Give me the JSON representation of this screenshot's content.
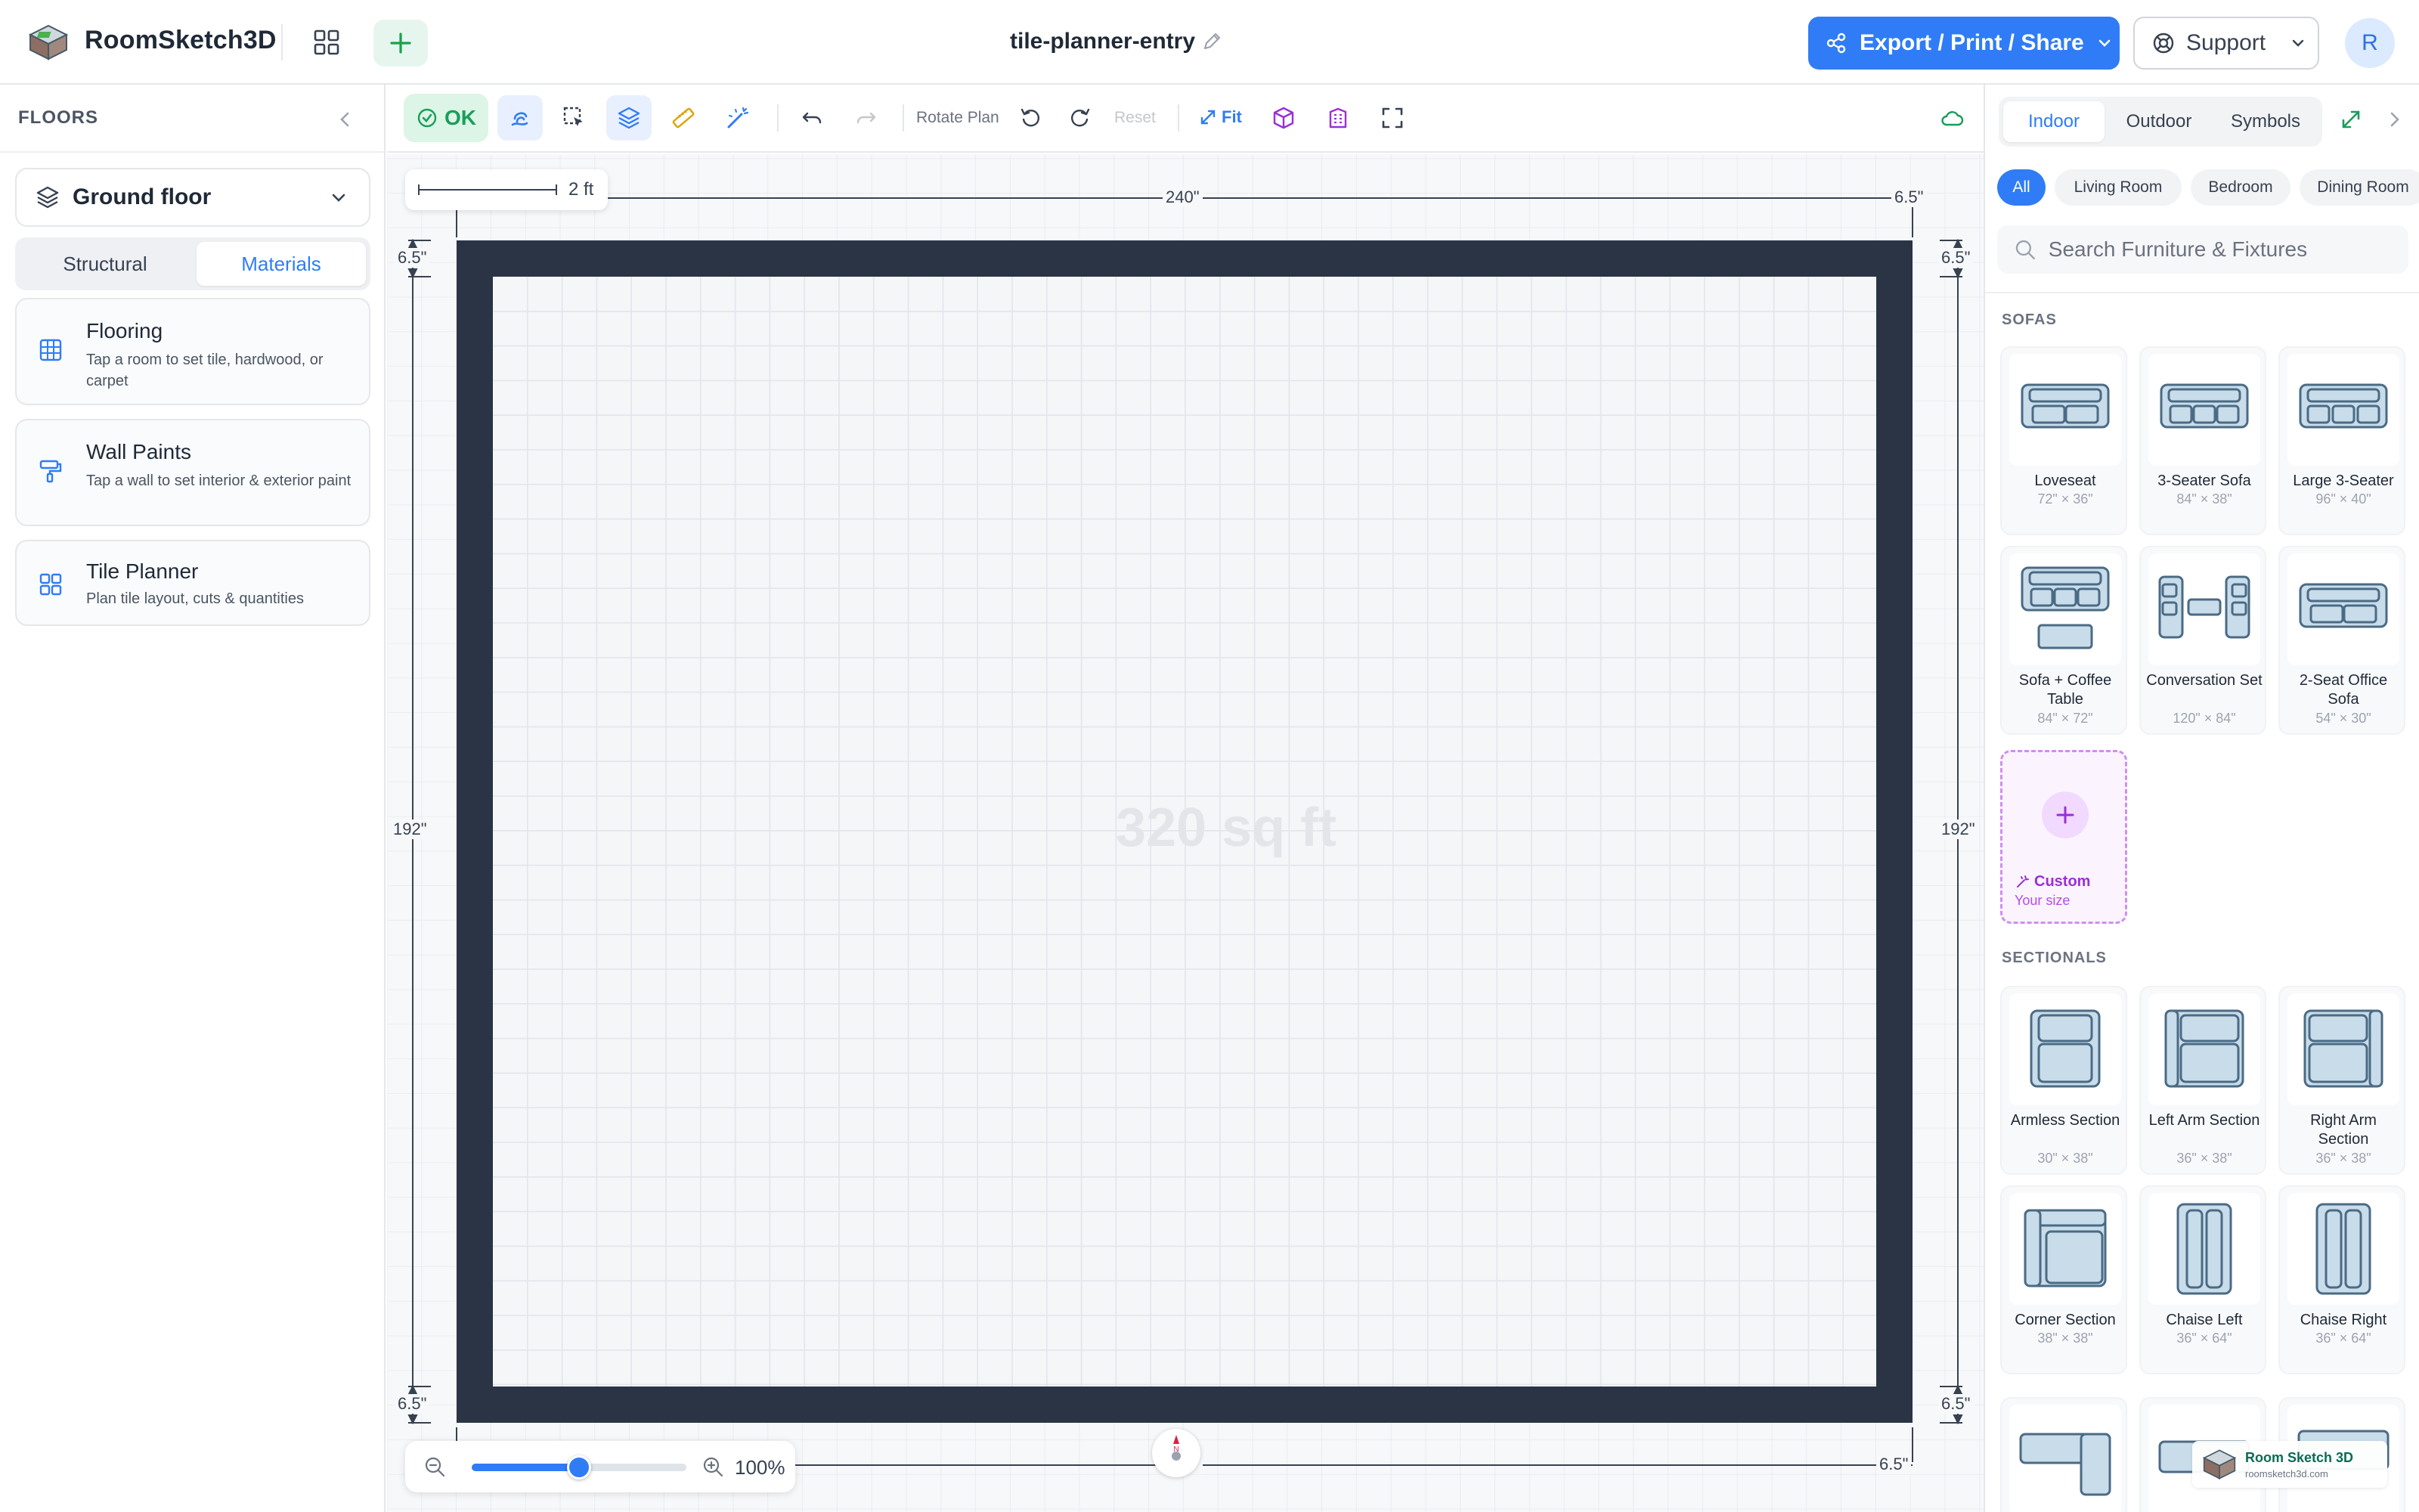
{
  "header": {
    "app_name": "RoomSketch3D",
    "project_title": "tile-planner-entry",
    "export_label": "Export / Print / Share",
    "support_label": "Support",
    "avatar_initial": "R",
    "accent_color": "#2f7cf6"
  },
  "sidebar": {
    "title": "FLOORS",
    "floor_selected": "Ground floor",
    "segments": [
      "Structural",
      "Materials"
    ],
    "active_segment": "Materials",
    "materials": [
      {
        "icon": "grid-icon",
        "title": "Flooring",
        "desc": "Tap a room to set tile, hardwood, or carpet"
      },
      {
        "icon": "paint-roller-icon",
        "title": "Wall Paints",
        "desc": "Tap a wall to set interior & exterior paint"
      },
      {
        "icon": "tiles-icon",
        "title": "Tile Planner",
        "desc": "Plan tile layout, cuts & quantities"
      }
    ]
  },
  "toolbar": {
    "ok_label": "OK",
    "rotate_label": "Rotate Plan",
    "reset_label": "Reset",
    "fit_label": "Fit"
  },
  "canvas": {
    "scale_label": "2 ft",
    "dim_width": "240\"",
    "dim_height": "192\"",
    "dim_wall": "6.5\"",
    "area_label": "320 sq ft",
    "zoom_label": "100%",
    "zoom_level": 0.5,
    "compass_n": "N"
  },
  "right_panel": {
    "tabs": [
      "Indoor",
      "Outdoor",
      "Symbols"
    ],
    "active_tab": "Indoor",
    "categories": [
      "All",
      "Living Room",
      "Bedroom",
      "Dining Room"
    ],
    "active_category": "All",
    "search_placeholder": "Search Furniture & Fixtures",
    "sections": [
      {
        "label": "SOFAS",
        "items": [
          {
            "name": "Loveseat",
            "size": "72\" × 36\"",
            "icon": "loveseat-icon"
          },
          {
            "name": "3-Seater Sofa",
            "size": "84\" × 38\"",
            "icon": "sofa-icon"
          },
          {
            "name": "Large 3-Seater",
            "size": "96\" × 40\"",
            "icon": "large-sofa-icon"
          },
          {
            "name": "Sofa + Coffee Table",
            "size": "84\" × 72\"",
            "icon": "sofa-table-icon"
          },
          {
            "name": "Conversation Set",
            "size": "120\" × 84\"",
            "icon": "conversation-set-icon"
          },
          {
            "name": "2-Seat Office Sofa",
            "size": "54\" × 30\"",
            "icon": "office-sofa-icon"
          }
        ]
      },
      {
        "label": "SECTIONALS",
        "items": [
          {
            "name": "Armless Section",
            "size": "30\" × 38\"",
            "icon": "armless-section-icon"
          },
          {
            "name": "Left Arm Section",
            "size": "36\" × 38\"",
            "icon": "left-arm-section-icon"
          },
          {
            "name": "Right Arm Section",
            "size": "36\" × 38\"",
            "icon": "right-arm-section-icon"
          },
          {
            "name": "Corner Section",
            "size": "38\" × 38\"",
            "icon": "corner-section-icon"
          },
          {
            "name": "Chaise Left",
            "size": "36\" × 64\"",
            "icon": "chaise-left-icon"
          },
          {
            "name": "Chaise Right",
            "size": "36\" × 64\"",
            "icon": "chaise-right-icon"
          }
        ]
      }
    ],
    "custom": {
      "title": "Custom",
      "sub": "Your size"
    }
  },
  "watermark": {
    "name": "Room Sketch 3D",
    "url": "roomsketch3d.com"
  }
}
